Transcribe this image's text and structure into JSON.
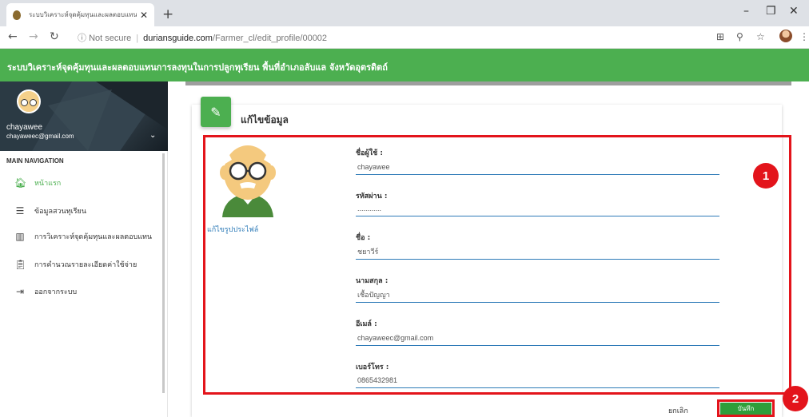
{
  "browser": {
    "tab_title": "ระบบวิเคราะห์จุดคุ้มทุนและผลตอบแทน",
    "url_security": "Not secure",
    "url_host": "duriansguide.com",
    "url_path": "/Farmer_cl/edit_profile/00002"
  },
  "app": {
    "title": "ระบบวิเคราะห์จุดคุ้มทุนและผลตอบแทนการลงทุนในการปลูกทุเรียน พื้นที่อำเภอลับแล จังหวัดอุตรดิตถ์",
    "accent_color": "#4caf50"
  },
  "sidebar": {
    "user_name": "chayawee",
    "user_email": "chayaweec@gmail.com",
    "nav_header": "MAIN NAVIGATION",
    "items": [
      {
        "label": "หน้าแรก",
        "icon": "home-icon"
      },
      {
        "label": "ข้อมูลสวนทุเรียน",
        "icon": "list-icon"
      },
      {
        "label": "การวิเคราะห์จุดคุ้มทุนและผลตอบแทน",
        "icon": "bar-chart-icon"
      },
      {
        "label": "การคำนวณรายละเอียดค่าใช้จ่าย",
        "icon": "clipboard-icon"
      },
      {
        "label": "ออกจากระบบ",
        "icon": "logout-icon"
      }
    ]
  },
  "form": {
    "title": "แก้ไขข้อมูล",
    "edit_photo_link": "แก้ไขรูปประไฟล์",
    "fields": {
      "username": {
        "label": "ชื่อผู้ใช้ :",
        "value": "chayawee"
      },
      "password": {
        "label": "รหัสผ่าน :",
        "value": "............"
      },
      "first_name": {
        "label": "ชื่อ :",
        "value": "ชยาวีร์"
      },
      "last_name": {
        "label": "นามสกุล :",
        "value": "เชื้อปัญญา"
      },
      "email": {
        "label": "อีเมล์ :",
        "value": "chayaweec@gmail.com"
      },
      "phone": {
        "label": "เบอร์โทร :",
        "value": "0865432981"
      }
    },
    "cancel_label": "ยกเลิก",
    "save_label": "บันทึก"
  },
  "annotations": {
    "badge_1": "1",
    "badge_2": "2",
    "highlight_color": "#e3141b"
  }
}
